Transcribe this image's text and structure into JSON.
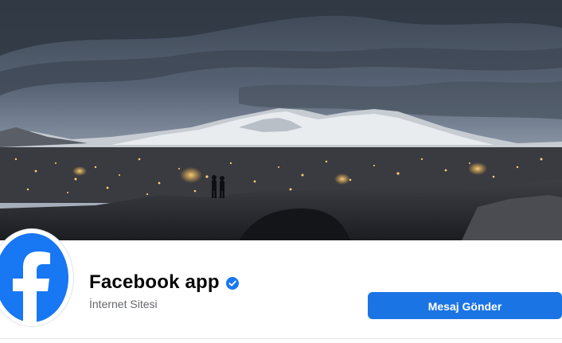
{
  "cover": {
    "photo": "dusk-city-lights-snowy-mountain"
  },
  "profile": {
    "name": "Facebook app",
    "verified_icon": "verified-check-icon",
    "category": "İnternet Sitesi",
    "avatar_icon": "facebook-logo-icon"
  },
  "actions": {
    "message_label": "Mesaj Gönder"
  },
  "colors": {
    "accent": "#1b74e4",
    "badge": "#1877f2",
    "name_text": "#050505",
    "secondary_text": "#65676b"
  }
}
